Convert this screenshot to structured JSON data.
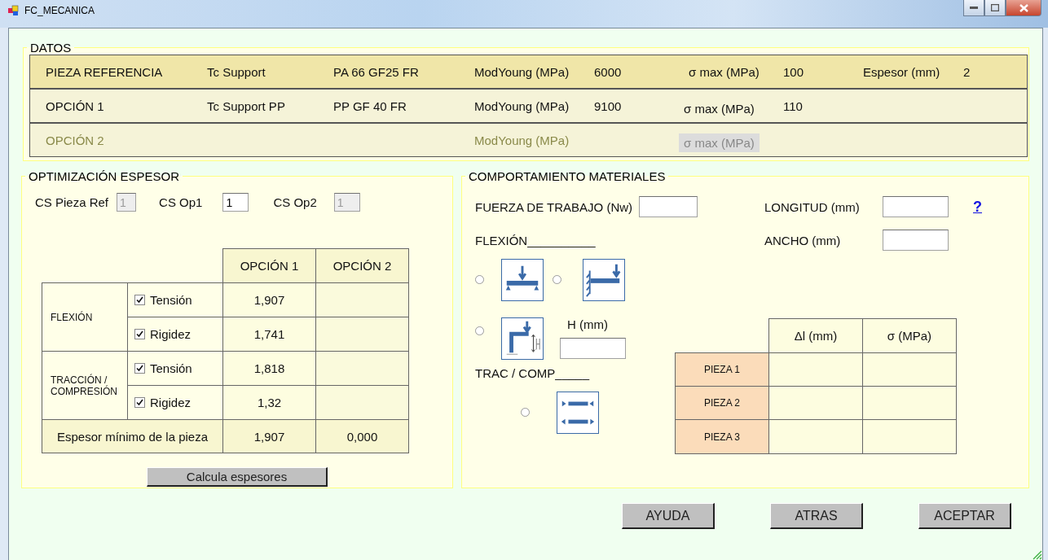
{
  "window": {
    "title": "FC_MECANICA"
  },
  "datos": {
    "title": "DATOS",
    "rows": [
      {
        "kind": "reference",
        "disabled": false,
        "label": "PIEZA REFERENCIA",
        "part": "Tc Support",
        "material": "PA 66 GF25 FR",
        "modulus_label": "ModYoung (MPa)",
        "modulus": "6000",
        "stress_label": "σ max (MPa)",
        "stress": "100",
        "thickness_label": "Espesor (mm)",
        "thickness": "2"
      },
      {
        "kind": "option",
        "disabled": false,
        "label": "OPCIÓN 1",
        "part": "Tc Support PP",
        "material": "PP GF 40 FR",
        "modulus_label": "ModYoung (MPa)",
        "modulus": "9100",
        "stress_label": "σ max (MPa)",
        "stress": "110"
      },
      {
        "kind": "option",
        "disabled": true,
        "label": "OPCIÓN 2",
        "modulus_label": "ModYoung (MPa)",
        "stress_label": "σ max (MPa)"
      }
    ]
  },
  "optimizacion": {
    "title": "OPTIMIZACIÓN ESPESOR",
    "safety_factors": [
      {
        "label": "CS Pieza Ref",
        "value": "1",
        "disabled": true
      },
      {
        "label": "CS Op1",
        "value": "1",
        "disabled": false
      },
      {
        "label": "CS Op2",
        "value": "1",
        "disabled": true
      }
    ],
    "columns": [
      "OPCIÓN 1",
      "OPCIÓN 2"
    ],
    "groups": [
      {
        "name": "FLEXIÓN",
        "rows": [
          {
            "label": "Tensión",
            "checked": true,
            "values": [
              "1,907"
            ]
          },
          {
            "label": "Rigidez",
            "checked": true,
            "values": [
              "1,741"
            ]
          }
        ]
      },
      {
        "name": "TRACCIÓN / COMPRESIÓN",
        "rows": [
          {
            "label": "Tensión",
            "checked": true,
            "values": [
              "1,818"
            ]
          },
          {
            "label": "Rigidez",
            "checked": true,
            "values": [
              "1,32"
            ]
          }
        ]
      }
    ],
    "summary": {
      "label": "Espesor mínimo de la pieza",
      "values": [
        "1,907",
        "0,000"
      ]
    },
    "button": "Calcula espesores"
  },
  "comportamiento": {
    "title": "COMPORTAMIENTO MATERIALES",
    "force_label": "FUERZA DE TRABAJO (Nw)",
    "length_label": "LONGITUD (mm)",
    "help": "?",
    "width_label": "ANCHO (mm)",
    "bending_title": "FLEXIÓN__________",
    "axial_title": "TRAC / COMP_____",
    "height_label": "H (mm)",
    "load_cases": [
      {
        "kind": "simply-supported",
        "selected": false
      },
      {
        "kind": "cantilever",
        "selected": false
      },
      {
        "kind": "bracket",
        "selected": false
      },
      {
        "kind": "axial",
        "selected": false
      }
    ],
    "results": {
      "columns": [
        "Δl (mm)",
        "σ (MPa)"
      ],
      "rows": [
        "PIEZA 1",
        "PIEZA 2",
        "PIEZA 3"
      ]
    }
  },
  "buttons": [
    "AYUDA",
    "ATRAS",
    "ACEPTAR"
  ]
}
